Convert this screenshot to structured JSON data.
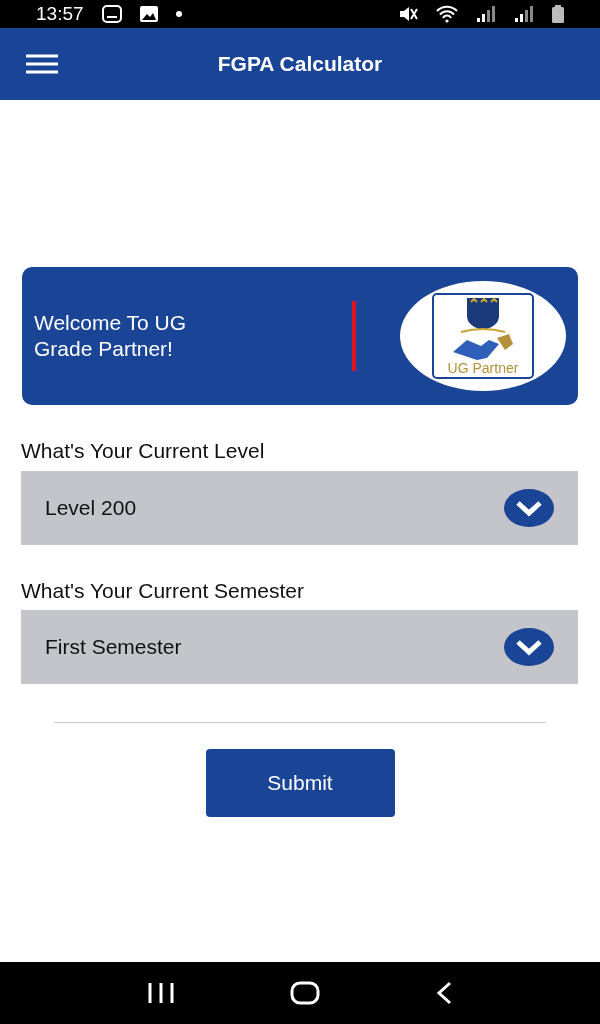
{
  "status_bar": {
    "time": "13:57"
  },
  "app_bar": {
    "title": "FGPA Calculator"
  },
  "welcome_card": {
    "message": "Welcome To UG Grade Partner!",
    "logo_caption": "UG Partner"
  },
  "fields": [
    {
      "label": "What's Your Current Level",
      "value": "Level 200"
    },
    {
      "label": "What's Your Current Semester",
      "value": "First Semester"
    }
  ],
  "submit_button": {
    "label": "Submit"
  }
}
